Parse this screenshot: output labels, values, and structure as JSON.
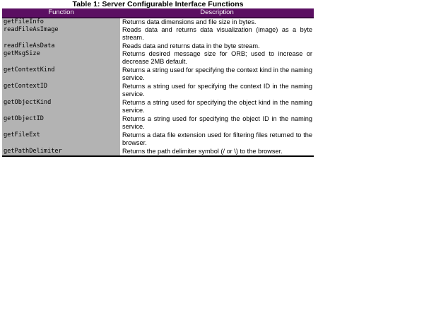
{
  "table": {
    "caption": "Table 1: Server Configurable Interface Functions",
    "headers": {
      "function": "Function",
      "description": "Description"
    },
    "rows": [
      {
        "function": "getFileInfo",
        "description": "Returns data dimensions and file size in bytes."
      },
      {
        "function": "readFileAsImage",
        "description": "Reads data and returns data visualization (image) as a byte stream."
      },
      {
        "function": "readFileAsData",
        "description": "Reads data and returns data in the byte stream."
      },
      {
        "function": "getMsgSize",
        "description": "Returns desired message size for ORB; used to increase or decrease 2MB default."
      },
      {
        "function": "getContextKind",
        "description": "Returns a string used for specifying the context kind in the naming service."
      },
      {
        "function": "getContextID",
        "description": "Returns a string used for specifying the context ID in the naming service."
      },
      {
        "function": "getObjectKind",
        "description": "Returns a string used for specifying the object kind in the naming service."
      },
      {
        "function": "getObjectID",
        "description": "Returns a string used for specifying the object ID in the naming service."
      },
      {
        "function": "getFileExt",
        "description": "Returns a data file extension used for filtering files returned to the browser."
      },
      {
        "function": "getPathDelimiter",
        "description": "Returns the path delimiter symbol (/ or \\) to the browser."
      }
    ]
  },
  "colors": {
    "header_bg": "#5b0f62",
    "header_text": "#ffffff",
    "function_column_bg": "#b3b3b3"
  }
}
